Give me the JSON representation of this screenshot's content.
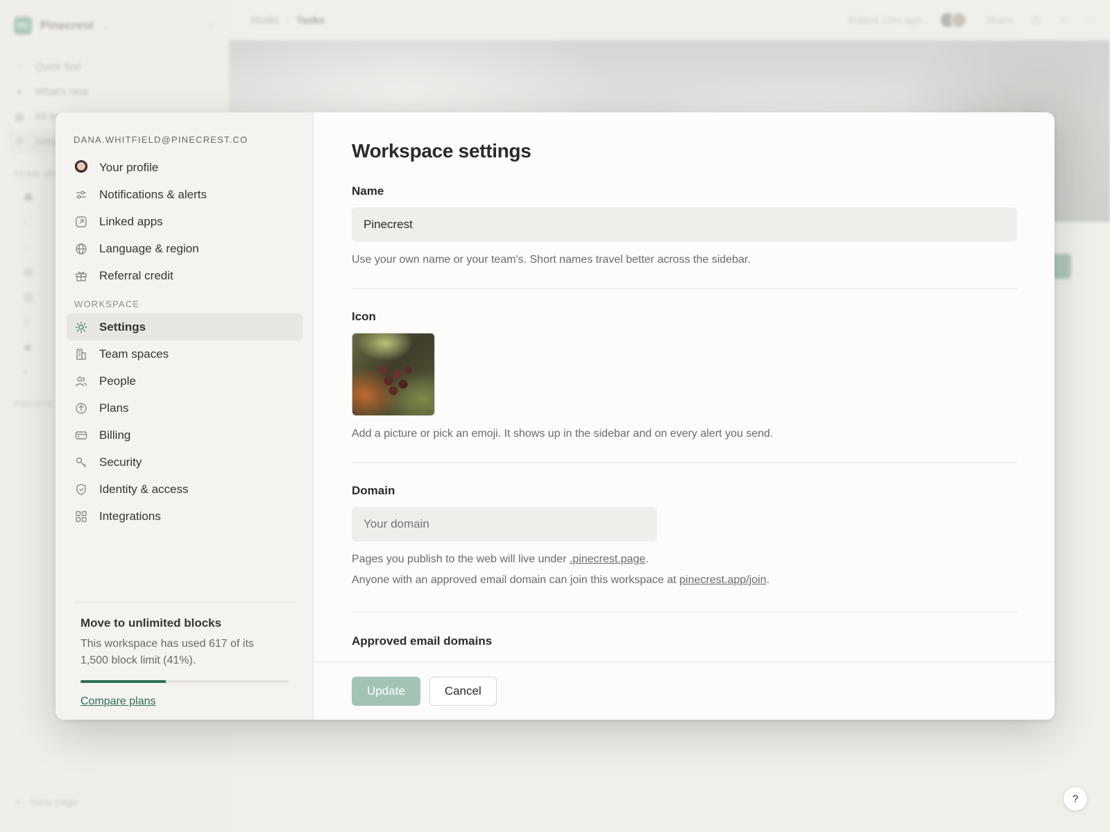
{
  "background": {
    "workspace": {
      "initials": "PC",
      "name": "Pinecrest"
    },
    "nav": [
      "Quick find",
      "What's new",
      "All team spaces",
      "Settings"
    ],
    "section_team": "TEAM SPACES",
    "section_private": "PRIVATE",
    "new_page": "New page",
    "breadcrumb": [
      "Studio",
      "Tasks"
    ],
    "edited": "Edited 12m ago",
    "share": "Share"
  },
  "modal": {
    "email": "DANA.WHITFIELD@PINECREST.CO",
    "account_items": [
      {
        "label": "Your profile",
        "icon": "avatar"
      },
      {
        "label": "Notifications & alerts",
        "icon": "sliders-icon"
      },
      {
        "label": "Linked apps",
        "icon": "external-link-icon"
      },
      {
        "label": "Language & region",
        "icon": "globe-icon"
      },
      {
        "label": "Referral credit",
        "icon": "gift-icon"
      }
    ],
    "workspace_section": "WORKSPACE",
    "workspace_items": [
      {
        "label": "Settings",
        "icon": "gear-icon",
        "active": true
      },
      {
        "label": "Team spaces",
        "icon": "building-icon"
      },
      {
        "label": "People",
        "icon": "people-icon"
      },
      {
        "label": "Plans",
        "icon": "arrow-up-circle-icon"
      },
      {
        "label": "Billing",
        "icon": "credit-card-icon"
      },
      {
        "label": "Security",
        "icon": "key-icon"
      },
      {
        "label": "Identity & access",
        "icon": "shield-icon"
      },
      {
        "label": "Integrations",
        "icon": "grid-icon"
      }
    ],
    "upgrade": {
      "title": "Move to unlimited blocks",
      "text": "This workspace has used 617 of its 1,500 block limit (41%).",
      "progress": 0.41,
      "link": "Compare plans"
    },
    "title": "Workspace settings",
    "name_field": {
      "label": "Name",
      "value": "Pinecrest",
      "help": "Use your own name or your team's. Short names travel better across the sidebar."
    },
    "icon_field": {
      "label": "Icon",
      "help": "Add a picture or pick an emoji. It shows up in the sidebar and on every alert you send."
    },
    "domain_field": {
      "label": "Domain",
      "placeholder": "Your domain",
      "help1_prefix": "Pages you publish to the web will live under ",
      "help1_link": ".pinecrest.page",
      "help1_suffix": ".",
      "help2_prefix": "Anyone with an approved email domain can join this workspace at ",
      "help2_link": "pinecrest.app/join",
      "help2_suffix": "."
    },
    "approved_label": "Approved email domains",
    "update_button": "Update",
    "cancel_button": "Cancel"
  },
  "help_button": "?",
  "colors": {
    "accent": "#3f8c6a",
    "accent_dark": "#2f6f55",
    "update_disabled": "#a3c4b5"
  }
}
